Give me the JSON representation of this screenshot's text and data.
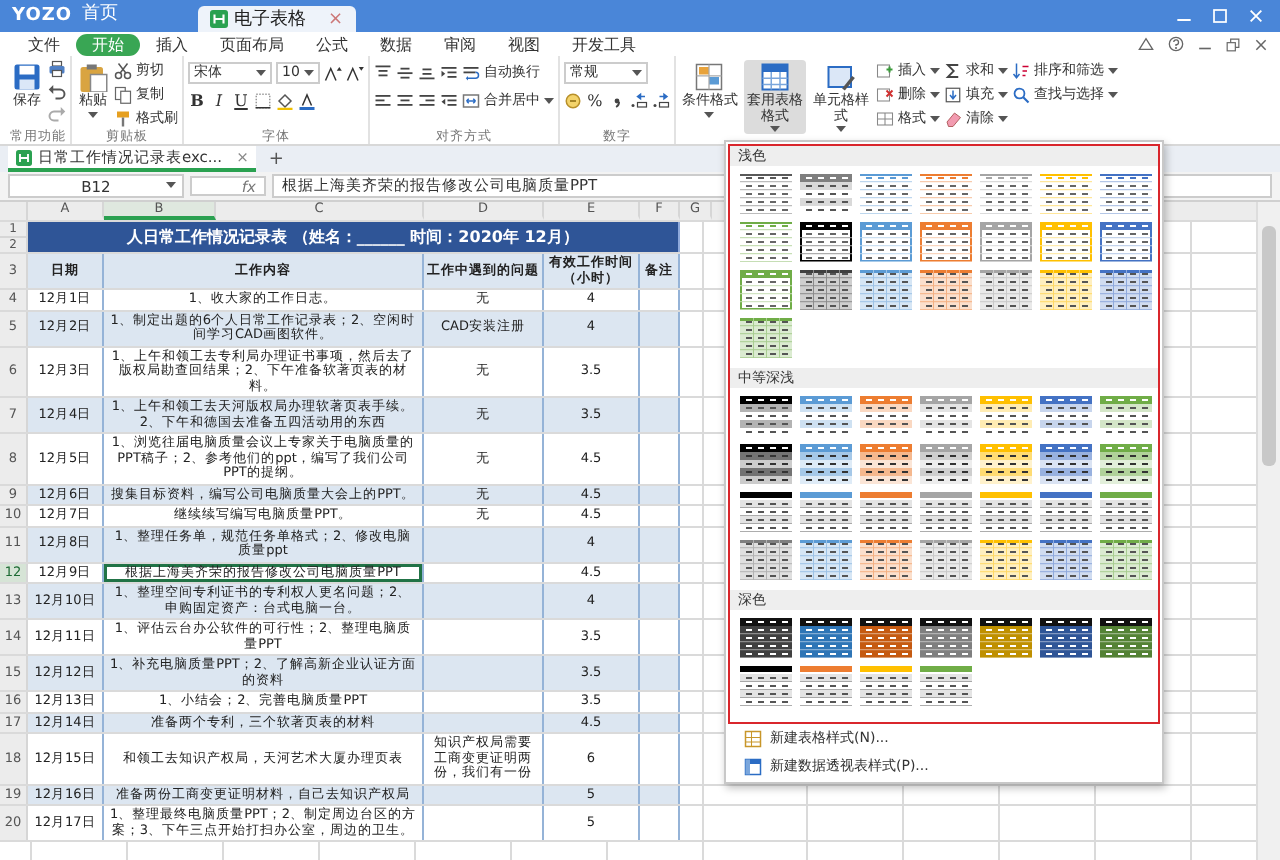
{
  "window": {
    "logo": "YOZO",
    "home_tab": "首页",
    "doc_tab": {
      "label": "电子表格",
      "close": "×"
    }
  },
  "menu": [
    {
      "label": "文件",
      "selected": false
    },
    {
      "label": "开始",
      "selected": true
    },
    {
      "label": "插入",
      "selected": false
    },
    {
      "label": "页面布局",
      "selected": false
    },
    {
      "label": "公式",
      "selected": false
    },
    {
      "label": "数据",
      "selected": false
    },
    {
      "label": "审阅",
      "selected": false
    },
    {
      "label": "视图",
      "selected": false
    },
    {
      "label": "开发工具",
      "selected": false
    }
  ],
  "ribbon": {
    "groups": [
      {
        "label": "常用功能",
        "items": [
          {
            "kind": "big",
            "label": "保存",
            "dropdown": false,
            "selected": false
          },
          {
            "kind": "column",
            "items": [
              {
                "kind": "icon"
              },
              {
                "kind": "icon"
              },
              {
                "kind": "icon"
              }
            ]
          }
        ]
      },
      {
        "label": "剪贴板",
        "items": [
          {
            "kind": "big",
            "label": "粘贴",
            "dropdown": true,
            "selected": false
          },
          {
            "kind": "column",
            "items": [
              {
                "kind": "small",
                "label": "剪切",
                "dropdown": false
              },
              {
                "kind": "small",
                "label": "复制",
                "dropdown": false
              },
              {
                "kind": "small",
                "label": "格式刷",
                "dropdown": false
              }
            ]
          }
        ]
      },
      {
        "label": "字体",
        "items": [
          {
            "kind": "column",
            "items": [
              {
                "kind": "row",
                "items": [
                  {
                    "kind": "field",
                    "value": "宋体"
                  },
                  {
                    "kind": "field",
                    "value": "10"
                  },
                  {
                    "kind": "icon"
                  },
                  {
                    "kind": "icon"
                  }
                ]
              },
              {
                "kind": "row",
                "items": [
                  {
                    "kind": "glyph",
                    "text": "B"
                  },
                  {
                    "kind": "glyph",
                    "text": "I"
                  },
                  {
                    "kind": "glyph",
                    "text": "U"
                  },
                  {
                    "kind": "icon"
                  },
                  {
                    "kind": "icon"
                  },
                  {
                    "kind": "icon"
                  }
                ]
              }
            ]
          }
        ]
      },
      {
        "label": "对齐方式",
        "items": [
          {
            "kind": "column",
            "items": [
              {
                "kind": "row",
                "items": [
                  {
                    "kind": "icon"
                  },
                  {
                    "kind": "icon"
                  },
                  {
                    "kind": "icon"
                  },
                  {
                    "kind": "icon"
                  },
                  {
                    "kind": "small",
                    "label": "自动换行",
                    "dropdown": false
                  }
                ]
              },
              {
                "kind": "row",
                "items": [
                  {
                    "kind": "icon"
                  },
                  {
                    "kind": "icon"
                  },
                  {
                    "kind": "icon"
                  },
                  {
                    "kind": "icon"
                  },
                  {
                    "kind": "small",
                    "label": "合并居中",
                    "dropdown": true
                  }
                ]
              }
            ]
          }
        ]
      },
      {
        "label": "数字",
        "items": [
          {
            "kind": "column",
            "items": [
              {
                "kind": "row",
                "items": [
                  {
                    "kind": "field",
                    "value": "常规"
                  }
                ]
              },
              {
                "kind": "row",
                "items": [
                  {
                    "kind": "icon"
                  },
                  {
                    "kind": "glyph",
                    "text": "%"
                  },
                  {
                    "kind": "icon"
                  },
                  {
                    "kind": "icon"
                  },
                  {
                    "kind": "icon"
                  }
                ]
              }
            ]
          }
        ]
      },
      {
        "items": [
          {
            "kind": "big",
            "label": "条件格式",
            "dropdown": true,
            "selected": false
          },
          {
            "kind": "big",
            "label": "套用表格格式",
            "dropdown": true,
            "selected": true
          },
          {
            "kind": "big",
            "label": "单元格样式",
            "dropdown": true,
            "selected": false
          },
          {
            "kind": "column",
            "items": [
              {
                "kind": "small",
                "label": "插入",
                "dropdown": true
              },
              {
                "kind": "small",
                "label": "删除",
                "dropdown": true
              },
              {
                "kind": "small",
                "label": "格式",
                "dropdown": true
              }
            ]
          },
          {
            "kind": "column",
            "items": [
              {
                "kind": "small",
                "label": "求和",
                "dropdown": true
              },
              {
                "kind": "small",
                "label": "填充",
                "dropdown": true
              },
              {
                "kind": "small",
                "label": "清除",
                "dropdown": true
              }
            ]
          },
          {
            "kind": "column",
            "items": [
              {
                "kind": "small",
                "label": "排序和筛选",
                "dropdown": true
              },
              {
                "kind": "small",
                "label": "查找与选择",
                "dropdown": true
              }
            ]
          }
        ]
      }
    ]
  },
  "doc_tabs": [
    {
      "label": "日常工作情况记录表exc...",
      "close": "×",
      "selected": true
    }
  ],
  "doc_tabs_add": "+",
  "formula_bar": {
    "cell": "B12",
    "fx": "fx",
    "value": "根据上海美齐荣的报告修改公司电脑质量PPT"
  },
  "sheet": {
    "column_headers": [
      "A",
      "B",
      "C",
      "D",
      "E",
      "F",
      "G"
    ],
    "title_rows": [
      "1",
      "2"
    ],
    "title": "人日常工作情况记录表 （姓名：______ 时间：2020年 12月）",
    "header_row": "3",
    "headers": [
      "日期",
      "工作内容",
      "工作中遇到的问题",
      "有效工作时间（小时）",
      "备注"
    ],
    "rows": [
      {
        "row": "4",
        "date": "12月1日",
        "content": "1、收大家的工作日志。",
        "issue": "无",
        "hours": "4",
        "selected": false
      },
      {
        "row": "5",
        "date": "12月2日",
        "content": "1、制定出题的6个人日常工作记录表；2、空闲时间学习CAD画图软件。",
        "issue": "CAD安装注册",
        "hours": "4",
        "selected": false
      },
      {
        "row": "6",
        "date": "12月3日",
        "content": "1、上午和领工去专利局办理证书事项，然后去了版权局勘查回结果；2、下午准备软著页表的材料。",
        "issue": "无",
        "hours": "3.5",
        "selected": false
      },
      {
        "row": "7",
        "date": "12月4日",
        "content": "1、上午和领工去天河版权局办理软著页表手续。2、下午和德国去准备五四活动用的东西",
        "issue": "无",
        "hours": "3.5",
        "selected": false
      },
      {
        "row": "8",
        "date": "12月5日",
        "content": "1、浏览往届电脑质量会议上专家关于电脑质量的PPT稿子；2、参考他们的ppt，编写了我们公司PPT的提纲。",
        "issue": "无",
        "hours": "4.5",
        "selected": false
      },
      {
        "row": "9",
        "date": "12月6日",
        "content": "搜集目标资料，编写公司电脑质量大会上的PPT。",
        "issue": "无",
        "hours": "4.5",
        "selected": false
      },
      {
        "row": "10",
        "date": "12月7日",
        "content": "继续续写编写电脑质量PPT。",
        "issue": "无",
        "hours": "4.5",
        "selected": false
      },
      {
        "row": "11",
        "date": "12月8日",
        "content": "1、整理任务单，规范任务单格式；2、修改电脑质量ppt",
        "hours": "4",
        "selected": false
      },
      {
        "row": "12",
        "date": "12月9日",
        "content": "根据上海美齐荣的报告修改公司电脑质量PPT",
        "hours": "4.5",
        "selected": true
      },
      {
        "row": "13",
        "date": "12月10日",
        "content": "1、整理空间专利证书的专利权人更名问题；2、申购固定资产：台式电脑一台。",
        "hours": "4",
        "selected": false
      },
      {
        "row": "14",
        "date": "12月11日",
        "content": "1、评估云台办公软件的可行性；2、整理电脑质量PPT",
        "hours": "3.5",
        "selected": false
      },
      {
        "row": "15",
        "date": "12月12日",
        "content": "1、补充电脑质量PPT；2、了解高新企业认证方面的资料",
        "hours": "3.5",
        "selected": false
      },
      {
        "row": "16",
        "date": "12月13日",
        "content": "1、小结会；2、完善电脑质量PPT",
        "hours": "3.5",
        "selected": false
      },
      {
        "row": "17",
        "date": "12月14日",
        "content": "准备两个专利，三个软著页表的材料",
        "hours": "4.5",
        "selected": false
      },
      {
        "row": "18",
        "date": "12月15日",
        "content": "和领工去知识产权局，天河艺术大厦办理页表",
        "issue": "知识产权局需要工商变更证明两份，我们有一份",
        "hours": "6",
        "selected": false
      },
      {
        "row": "19",
        "date": "12月16日",
        "content": "准备两份工商变更证明材料，自己去知识产权局",
        "hours": "5",
        "selected": false
      },
      {
        "row": "20",
        "date": "12月17日",
        "content": "1、整理最终电脑质量PPT；2、制定周边台区的方案；3、下午三点开始打扫办公室，周边的卫生。",
        "hours": "5",
        "selected": false
      }
    ]
  },
  "style_gallery": {
    "sections": [
      {
        "label": "浅色",
        "styles": [
          {
            "kind": "lines",
            "color": "#595959"
          },
          {
            "kind": "banded",
            "color": "#7f7f7f"
          },
          {
            "kind": "lines",
            "color": "#5b9bd5"
          },
          {
            "kind": "lines",
            "color": "#ed7d31"
          },
          {
            "kind": "lines",
            "color": "#a5a5a5"
          },
          {
            "kind": "lines",
            "color": "#ffc000"
          },
          {
            "kind": "lines",
            "color": "#4472c4"
          },
          {
            "kind": "lines",
            "color": "#70ad47"
          },
          {
            "kind": "header",
            "color": "#000000"
          },
          {
            "kind": "header",
            "color": "#5b9bd5"
          },
          {
            "kind": "header",
            "color": "#ed7d31"
          },
          {
            "kind": "header",
            "color": "#a5a5a5"
          },
          {
            "kind": "header",
            "color": "#ffc000"
          },
          {
            "kind": "header",
            "color": "#4472c4"
          },
          {
            "kind": "header",
            "color": "#70ad47"
          },
          {
            "kind": "grid",
            "color": "#404040"
          },
          {
            "kind": "grid",
            "color": "#5b9bd5"
          },
          {
            "kind": "grid",
            "color": "#ed7d31"
          },
          {
            "kind": "grid",
            "color": "#a5a5a5"
          },
          {
            "kind": "grid",
            "color": "#ffc000"
          },
          {
            "kind": "grid",
            "color": "#4472c4"
          },
          {
            "kind": "grid",
            "color": "#70ad47"
          }
        ]
      },
      {
        "label": "中等深浅",
        "styles": [
          {
            "kind": "banded",
            "color": "#000000"
          },
          {
            "kind": "banded",
            "color": "#5b9bd5"
          },
          {
            "kind": "banded",
            "color": "#ed7d31"
          },
          {
            "kind": "banded",
            "color": "#a5a5a5"
          },
          {
            "kind": "banded",
            "color": "#ffc000"
          },
          {
            "kind": "banded",
            "color": "#4472c4"
          },
          {
            "kind": "banded",
            "color": "#70ad47"
          },
          {
            "kind": "striped",
            "color": "#000000"
          },
          {
            "kind": "striped",
            "color": "#5b9bd5"
          },
          {
            "kind": "striped",
            "color": "#ed7d31"
          },
          {
            "kind": "striped",
            "color": "#a5a5a5"
          },
          {
            "kind": "striped",
            "color": "#ffc000"
          },
          {
            "kind": "striped",
            "color": "#4472c4"
          },
          {
            "kind": "striped",
            "color": "#70ad47"
          },
          {
            "kind": "accent",
            "color": "#000000"
          },
          {
            "kind": "accent",
            "color": "#5b9bd5"
          },
          {
            "kind": "accent",
            "color": "#ed7d31"
          },
          {
            "kind": "accent",
            "color": "#a5a5a5"
          },
          {
            "kind": "accent",
            "color": "#ffc000"
          },
          {
            "kind": "accent",
            "color": "#4472c4"
          },
          {
            "kind": "accent",
            "color": "#70ad47"
          },
          {
            "kind": "grid",
            "color": "#7f7f7f"
          },
          {
            "kind": "grid",
            "color": "#5b9bd5"
          },
          {
            "kind": "grid",
            "color": "#ed7d31"
          },
          {
            "kind": "grid",
            "color": "#a5a5a5"
          },
          {
            "kind": "grid",
            "color": "#ffc000"
          },
          {
            "kind": "grid",
            "color": "#4472c4"
          },
          {
            "kind": "grid",
            "color": "#70ad47"
          }
        ]
      },
      {
        "label": "深色",
        "styles": [
          {
            "kind": "dark",
            "color": "#404040"
          },
          {
            "kind": "dark",
            "color": "#2e75b6"
          },
          {
            "kind": "dark",
            "color": "#c55a11"
          },
          {
            "kind": "dark",
            "color": "#7f7f7f"
          },
          {
            "kind": "dark",
            "color": "#bf9000"
          },
          {
            "kind": "dark",
            "color": "#2f5597"
          },
          {
            "kind": "dark",
            "color": "#548235"
          },
          {
            "kind": "accent",
            "color": "#000000"
          },
          {
            "kind": "accent",
            "color": "#ed7d31"
          },
          {
            "kind": "accent",
            "color": "#ffc000"
          },
          {
            "kind": "accent",
            "color": "#70ad47"
          }
        ]
      }
    ],
    "actions": [
      {
        "label": "新建表格样式(N)..."
      },
      {
        "label": "新建数据透视表样式(P)..."
      }
    ]
  }
}
